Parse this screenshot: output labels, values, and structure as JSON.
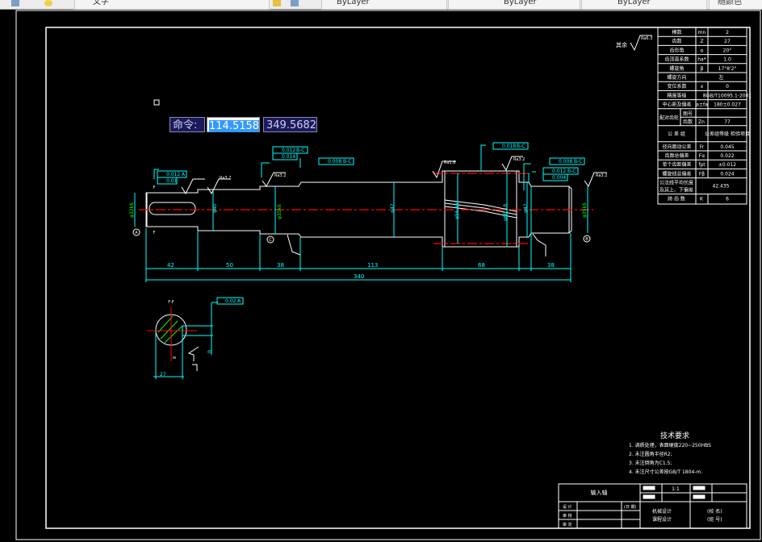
{
  "toolbar": {
    "layer_name": "文字",
    "color": "ByLayer",
    "linetype": "ByLayer",
    "lineweight": "ByLayer",
    "plot_style": "随颜色"
  },
  "command_tooltip": {
    "label": "命令:",
    "x_value": "114.5158",
    "y_value": "349.5682"
  },
  "drawing": {
    "colors": {
      "background": "#000000",
      "outline": "#ffffff",
      "dimension": "#00ffff",
      "centerline": "#ff0000",
      "tolerance": "#00ff00"
    },
    "roughness_other": "其余",
    "roughness_values": [
      "Ra6.3",
      "Ra3.2",
      "Ra3.2",
      "Ra1.6",
      "Ra3.2",
      "Ra3.2",
      "Ra1.6",
      "Ra1.6",
      "Ra1.6",
      "Ra3.2"
    ],
    "gtol": {
      "left_runout": "0.012",
      "left_runout_ref": "A",
      "left_cyl": "0.01",
      "mid_runout": "0.012",
      "mid_runout_ref": "B-C",
      "mid_cyl": "0.014",
      "shaft_runout": "0.008",
      "shaft_runout_ref": "B-C",
      "gear_runout": "0.018",
      "gear_runout_ref": "B-C",
      "right1_runout": "0.008",
      "right1_runout_ref": "B-C",
      "right2_runout": "0.012",
      "right2_runout_ref": "B-C",
      "right2_cyl": "0.004",
      "section_sym": "0.02",
      "section_sym_ref": "A"
    },
    "datums": [
      "A",
      "C",
      "B"
    ],
    "section_label": "F-F",
    "section_cut": "F",
    "diameters": [
      "φ32k6",
      "φ40",
      "φ35k6",
      "φ42",
      "φ56.88",
      "φ60.18",
      "φ42",
      "φ35k6"
    ],
    "section_dims": [
      "8",
      "27",
      "B"
    ],
    "segment_dims": [
      "42",
      "50",
      "38",
      "113",
      "68",
      "38"
    ],
    "total_length": "340"
  },
  "gear_table": {
    "rows": [
      {
        "name": "模数",
        "symbol": "mn",
        "value": "2"
      },
      {
        "name": "齿数",
        "symbol": "Z",
        "value": "27"
      },
      {
        "name": "齿形角",
        "symbol": "α",
        "value": "20°"
      },
      {
        "name": "齿顶高系数",
        "symbol": "ha*",
        "value": "1.0"
      },
      {
        "name": "螺旋角",
        "symbol": "β",
        "value": "17°8'2\""
      },
      {
        "name": "螺旋方向",
        "symbol": "",
        "value": "左"
      },
      {
        "name": "变位系数",
        "symbol": "x",
        "value": "0"
      },
      {
        "name": "精度等级",
        "symbol": "",
        "value": "8GB/T10095.1-2001"
      },
      {
        "name": "中心距及偏差",
        "symbol": "a±fa",
        "value": "180±0.027"
      }
    ],
    "mate": {
      "name": "配对齿轮",
      "sub1": "图号",
      "sub1_symbol": "",
      "sub1_value": "",
      "sub2": "齿数",
      "sub2_symbol": "Zn",
      "sub2_value": "77"
    },
    "tolerance_group": {
      "name": "公 差 组",
      "value": "公差组等级 检验项目"
    },
    "tol_rows": [
      {
        "name": "径向跳动公差",
        "symbol": "Fr",
        "value": "0.045"
      },
      {
        "name": "齿廓总偏差",
        "symbol": "Fα",
        "value": "0.022"
      },
      {
        "name": "单个齿距偏差",
        "symbol": "fpt",
        "value": "±0.012"
      },
      {
        "name": "螺旋线总偏差",
        "symbol": "Fβ",
        "value": "0.024"
      }
    ],
    "base_tangent": {
      "name1": "公法线平均长度",
      "name2": "及其上、下偏差",
      "value": "42.435"
    },
    "span": {
      "name": "跨 齿 数",
      "symbol": "K",
      "value": "6"
    }
  },
  "tech_requirements": {
    "title": "技术要求",
    "items": [
      "1. 调质处理，表面硬度220~250HBS",
      "2. 未注圆角半径R2;",
      "3. 未注倒角为C1.5;",
      "4. 未注尺寸公差按GB/T 1804-m."
    ]
  },
  "title_block": {
    "part_name": "输入轴",
    "scale": "1:1",
    "designer": "设 计",
    "checker": "审 核",
    "approver": "审 定",
    "date": "(日 期)",
    "course1": "机械设计",
    "course2": "课程设计",
    "school": "(校 名)",
    "class": "(班 号)"
  }
}
